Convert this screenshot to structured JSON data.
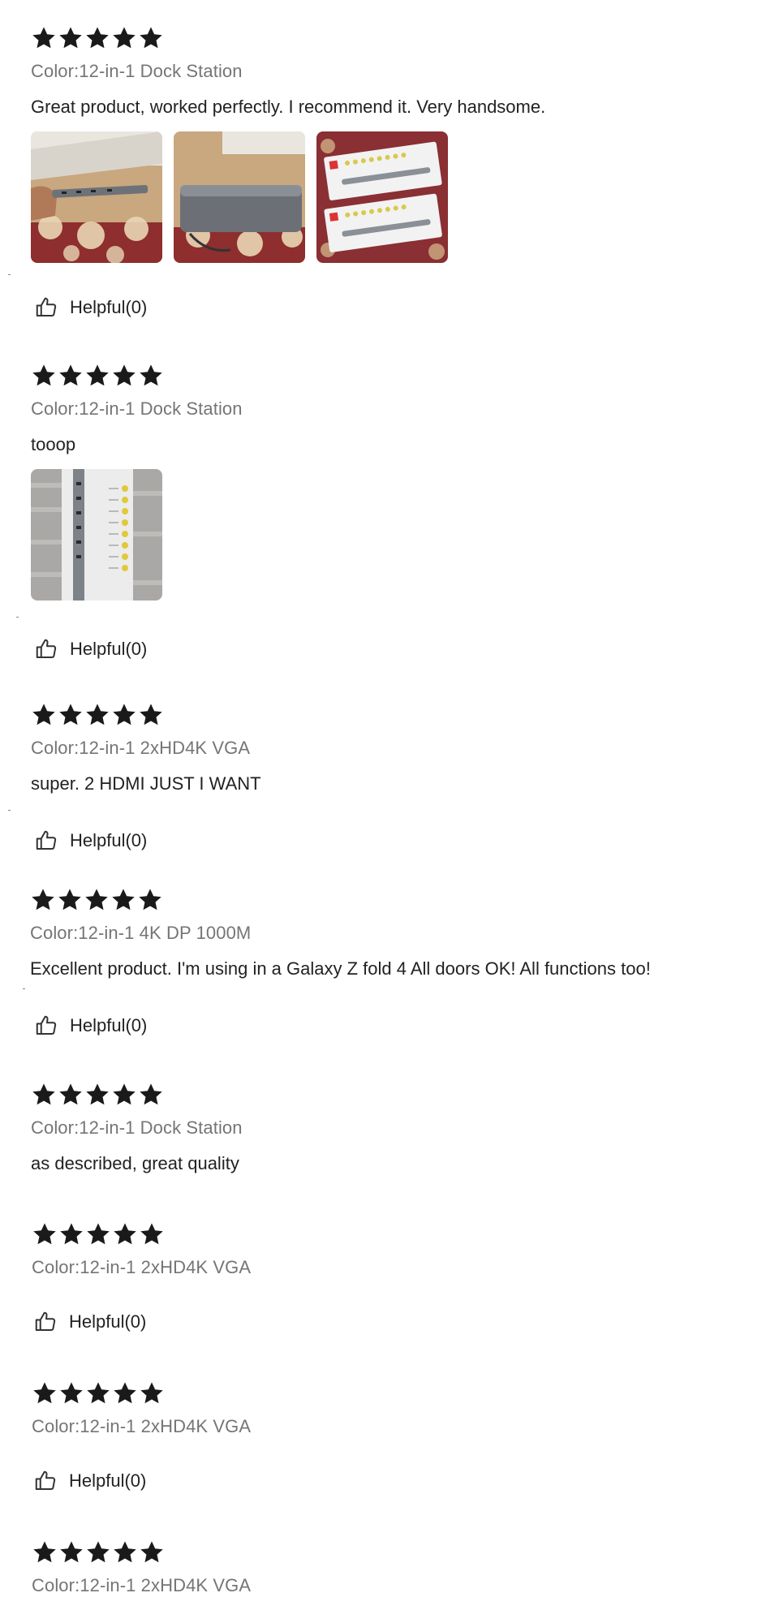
{
  "reviews": [
    {
      "rating": 5,
      "variant": "Color:12-in-1 Dock Station",
      "text": "Great product, worked perfectly. I recommend it. Very handsome.",
      "photos": [
        "photo-dock-in-hand",
        "photo-dock-closeup",
        "photo-dock-boxes"
      ],
      "helpful": "Helpful(0)"
    },
    {
      "rating": 5,
      "variant": "Color:12-in-1 Dock Station",
      "text": "tooop",
      "photos": [
        "photo-dock-box-ports"
      ],
      "helpful": "Helpful(0)"
    },
    {
      "rating": 5,
      "variant": "Color:12-in-1 2xHD4K VGA",
      "text": "super. 2 HDMI JUST I WANT",
      "helpful": "Helpful(0)"
    },
    {
      "rating": 5,
      "variant": "Color:12-in-1 4K DP 1000M",
      "text": "Excellent product. I'm using in a Galaxy Z fold 4 All doors OK! All functions too!",
      "helpful": "Helpful(0)"
    },
    {
      "rating": 5,
      "variant": "Color:12-in-1 Dock Station",
      "text": "as described, great quality"
    },
    {
      "rating": 5,
      "variant": "Color:12-in-1 2xHD4K VGA",
      "helpful": "Helpful(0)"
    },
    {
      "rating": 5,
      "variant": "Color:12-in-1 2xHD4K VGA",
      "helpful": "Helpful(0)"
    },
    {
      "rating": 5,
      "variant": "Color:12-in-1 2xHD4K VGA"
    }
  ],
  "colors": {
    "star": "#1a1a1a",
    "variant": "#757575",
    "text": "#222222"
  },
  "icons": {
    "star": "star-icon",
    "helpful": "thumbs-up-icon"
  }
}
